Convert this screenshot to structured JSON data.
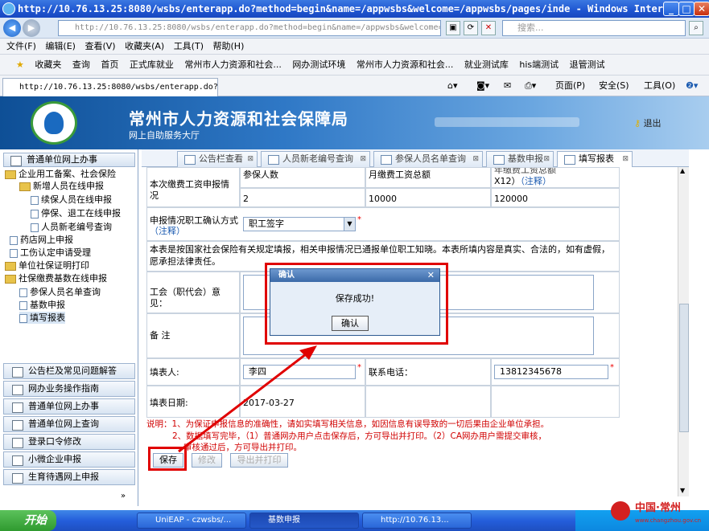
{
  "browser": {
    "title": "http://10.76.13.25:8080/wsbs/enterapp.do?method=begin&name=/appwsbs&welcome=/appwsbs/pages/inde - Windows Interne...",
    "address": "http://10.76.13.25:8080/wsbs/enterapp.do?method=begin&name=/appwsbs&welcome=/appwsbs/",
    "search_placeholder": "搜索...",
    "menu": [
      "文件(F)",
      "编辑(E)",
      "查看(V)",
      "收藏夹(A)",
      "工具(T)",
      "帮助(H)"
    ],
    "favorites_label": "收藏夹",
    "favorites": [
      "查询",
      "首页",
      "正式库就业",
      "常州市人力资源和社会...",
      "网办测试环境",
      "常州市人力资源和社会...",
      "就业测试库",
      "his端测试",
      "退管测试"
    ],
    "tab_title": "http://10.76.13.25:8080/wsbs/enterapp.do?...",
    "tools": {
      "page": "页面(P)",
      "safety": "安全(S)",
      "tools": "工具(O)"
    }
  },
  "app": {
    "title": "常州市人力资源和社会保障局",
    "subtitle": "网上自助服务大厅",
    "logout": "退出"
  },
  "sidebar": {
    "top": "普通单位网上办事",
    "tree": [
      {
        "label": "企业用工备案、社会保险",
        "level": 0,
        "kind": "folder"
      },
      {
        "label": "新增人员在线申报",
        "level": 1,
        "kind": "folder"
      },
      {
        "label": "续保人员在线申报",
        "level": 2,
        "kind": "doc"
      },
      {
        "label": "停保、退工在线申报",
        "level": 2,
        "kind": "doc"
      },
      {
        "label": "人员新老编号查询",
        "level": 2,
        "kind": "doc"
      },
      {
        "label": "药店网上申报",
        "level": 0,
        "kind": "doc"
      },
      {
        "label": "工伤认定申请受理",
        "level": 0,
        "kind": "doc"
      },
      {
        "label": "单位社保证明打印",
        "level": 0,
        "kind": "folder"
      },
      {
        "label": "社保缴费基数在线申报",
        "level": 0,
        "kind": "folder"
      },
      {
        "label": "参保人员名单查询",
        "level": 1,
        "kind": "doc"
      },
      {
        "label": "基数申报",
        "level": 1,
        "kind": "doc"
      },
      {
        "label": "填写报表",
        "level": 1,
        "kind": "doc"
      }
    ],
    "buttons": [
      "公告栏及常见问题解答",
      "网办业务操作指南",
      "普通单位网上办事",
      "普通单位网上查询",
      "登录口令修改",
      "小微企业申报",
      "生育待遇网上申报"
    ]
  },
  "tabs": [
    "公告栏查看",
    "人员新老编号查询",
    "参保人员名单查询",
    "基数申报",
    "填写报表"
  ],
  "form": {
    "section_label": "本次缴费工资申报情况",
    "col1_header": "参保人数",
    "col2_header": "月缴费工资总额",
    "col3_header": "年缴费工资总额",
    "col3_suffix": "X12）",
    "note_link": "（注释）",
    "col1_value": "2",
    "col2_value": "10000",
    "col3_value": "120000",
    "confirm_label": "申报情况职工确认方式",
    "confirm_value": "职工签字",
    "statement": "本表是按国家社会保险有关规定填报，相关申报情况已通报单位职工知晓。本表所填内容是真实、合法的，如有虚假，愿承担法律责任。",
    "union_label": "工会（职代会）意见：",
    "remark_label": "备    注",
    "filler_label": "填表人:",
    "filler_value": "李四",
    "phone_label": "联系电话：",
    "phone_value": "13812345678",
    "date_label": "填表日期:",
    "date_value": "2017-03-27",
    "notes": [
      "说明：1、为保证申报信息的准确性，请如实填写相关信息，如因信息有误导致的一切后果由企业单位承担。",
      "2、数据填写完毕，（1）普通网办用户点击保存后，方可导出并打印。（2）CA网办用户需提交审核，",
      "审核通过后，方可导出并打印。"
    ],
    "buttons": {
      "save": "保存",
      "edit": "修改",
      "export": "导出并打印"
    }
  },
  "dialog": {
    "title": "确认",
    "message": "保存成功!",
    "ok": "确认"
  },
  "taskbar": {
    "start": "开始",
    "tasks": [
      "UniEAP - czwsbs/...",
      "基数申报",
      "http://10.76.13..."
    ]
  },
  "watermark": {
    "text": "中国·常州",
    "site": "www.changzhou.gov.cn"
  },
  "colors": {
    "highlight_red": "#e00000",
    "header_blue": "#2f78c6",
    "note_red": "#d00000"
  }
}
